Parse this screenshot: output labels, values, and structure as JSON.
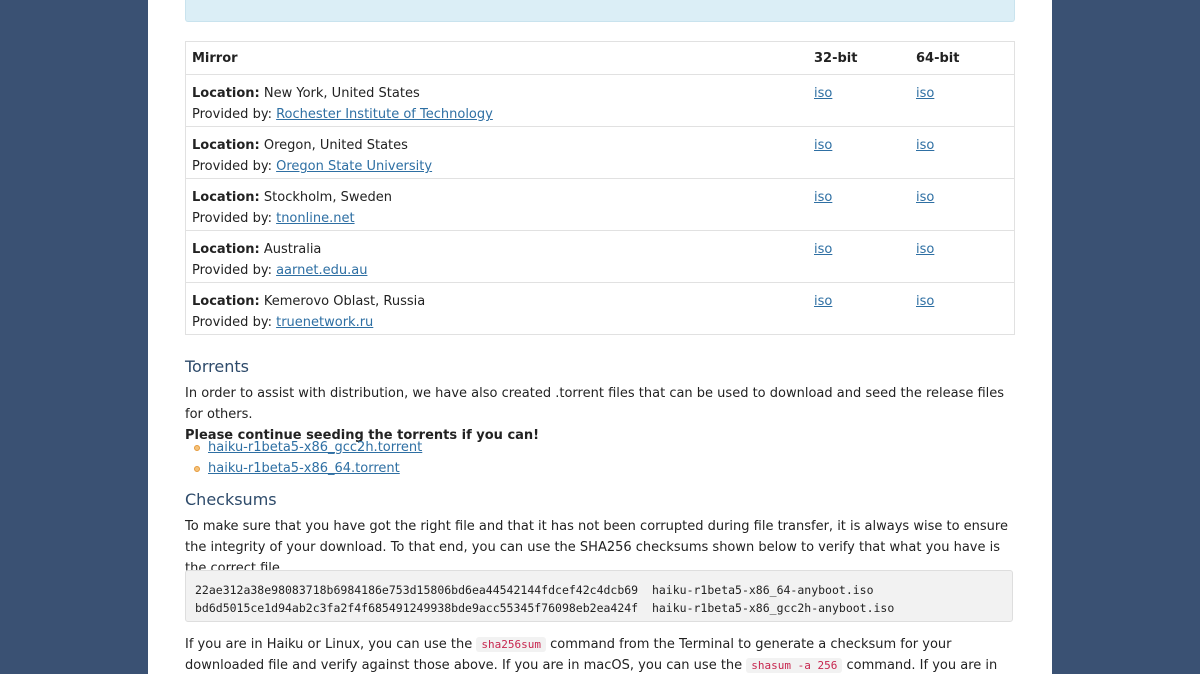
{
  "table": {
    "headers": {
      "mirror": "Mirror",
      "bit32": "32-bit",
      "bit64": "64-bit"
    },
    "location_label": "Location:",
    "provided_label": "Provided by:",
    "rows": [
      {
        "location": "New York, United States",
        "provider": "Rochester Institute of Technology",
        "iso32": "iso",
        "iso64": "iso"
      },
      {
        "location": "Oregon, United States",
        "provider": "Oregon State University",
        "iso32": "iso",
        "iso64": "iso"
      },
      {
        "location": "Stockholm, Sweden",
        "provider": "tnonline.net",
        "iso32": "iso",
        "iso64": "iso"
      },
      {
        "location": "Australia",
        "provider": "aarnet.edu.au",
        "iso32": "iso",
        "iso64": "iso"
      },
      {
        "location": "Kemerovo Oblast, Russia",
        "provider": "truenetwork.ru",
        "iso32": "iso",
        "iso64": "iso"
      }
    ]
  },
  "torrents": {
    "title": "Torrents",
    "text": "In order to assist with distribution, we have also created .torrent files that can be used to download and seed the release files for others.",
    "bold_text": "Please continue seeding the torrents if you can!",
    "files": [
      "haiku-r1beta5-x86_gcc2h.torrent",
      "haiku-r1beta5-x86_64.torrent"
    ]
  },
  "checksums": {
    "title": "Checksums",
    "text": "To make sure that you have got the right file and that it has not been corrupted during file transfer, it is always wise to ensure the integrity of your download. To that end, you can use the SHA256 checksums shown below to verify that what you have is the correct file.",
    "lines": [
      "22ae312a38e98083718b6984186e753d15806bd6ea44542144fdcef42c4dcb69  haiku-r1beta5-x86_64-anyboot.iso",
      "bd6d5015ce1d94ab2c3fa2f4f685491249938bde9acc55345f76098eb2ea424f  haiku-r1beta5-x86_gcc2h-anyboot.iso"
    ],
    "after_1": "If you are in Haiku or Linux, you can use the",
    "cmd_1": "sha256sum",
    "after_2": "command from the Terminal to generate a checksum for your downloaded file and verify against those above. If you are in macOS, you can use the",
    "cmd_2": "shasum -a 256",
    "after_3": "command. If you are in Windows, you can use the shell command"
  }
}
